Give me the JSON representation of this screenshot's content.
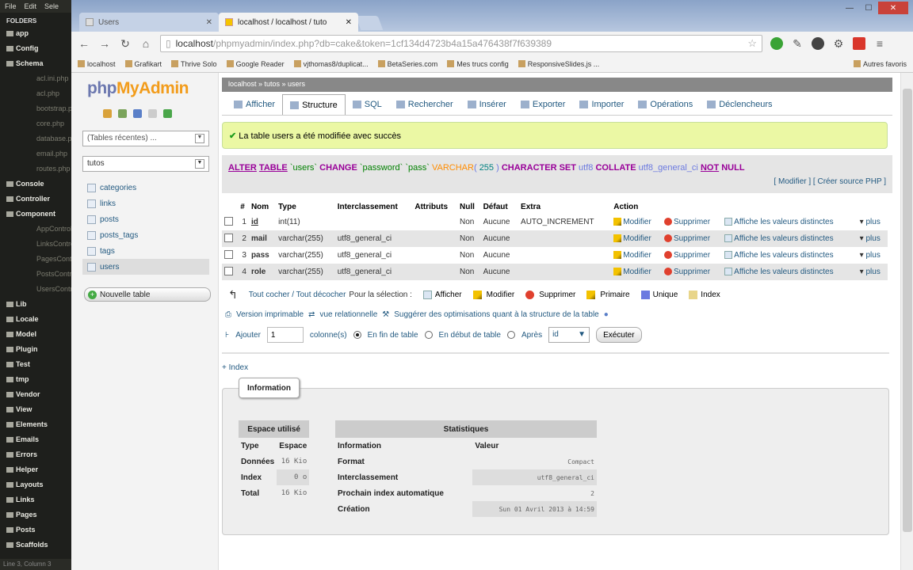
{
  "editor": {
    "menu": [
      "File",
      "Edit",
      "Sele"
    ],
    "folders_label": "FOLDERS",
    "tree": [
      {
        "label": "app",
        "type": "f"
      },
      {
        "label": "Config",
        "type": "f"
      },
      {
        "label": "Schema",
        "type": "f"
      },
      {
        "label": "acl.ini.php",
        "type": "fl"
      },
      {
        "label": "acl.php",
        "type": "fl"
      },
      {
        "label": "bootstrap.php",
        "type": "fl"
      },
      {
        "label": "core.php",
        "type": "fl"
      },
      {
        "label": "database.php",
        "type": "fl"
      },
      {
        "label": "email.php",
        "type": "fl"
      },
      {
        "label": "routes.php",
        "type": "fl"
      },
      {
        "label": "Console",
        "type": "f"
      },
      {
        "label": "Controller",
        "type": "f"
      },
      {
        "label": "Component",
        "type": "f"
      },
      {
        "label": "AppController",
        "type": "fl"
      },
      {
        "label": "LinksController",
        "type": "fl"
      },
      {
        "label": "PagesController",
        "type": "fl"
      },
      {
        "label": "PostsController",
        "type": "fl"
      },
      {
        "label": "UsersController",
        "type": "fl"
      },
      {
        "label": "Lib",
        "type": "f"
      },
      {
        "label": "Locale",
        "type": "f"
      },
      {
        "label": "Model",
        "type": "f"
      },
      {
        "label": "Plugin",
        "type": "f"
      },
      {
        "label": "Test",
        "type": "f"
      },
      {
        "label": "tmp",
        "type": "f"
      },
      {
        "label": "Vendor",
        "type": "f"
      },
      {
        "label": "View",
        "type": "f"
      },
      {
        "label": "Elements",
        "type": "f"
      },
      {
        "label": "Emails",
        "type": "f"
      },
      {
        "label": "Errors",
        "type": "f"
      },
      {
        "label": "Helper",
        "type": "f"
      },
      {
        "label": "Layouts",
        "type": "f"
      },
      {
        "label": "Links",
        "type": "f"
      },
      {
        "label": "Pages",
        "type": "f"
      },
      {
        "label": "Posts",
        "type": "f"
      },
      {
        "label": "Scaffolds",
        "type": "f"
      }
    ],
    "status": "Line 3, Column 3"
  },
  "browser": {
    "tab1": "Users",
    "tab2": "localhost / localhost / tuto",
    "url_host": "localhost",
    "url_rest": "/phpmyadmin/index.php?db=cake&token=1cf134d4723b4a15a476438f7f639389",
    "bookmarks": [
      "localhost",
      "Grafikart",
      "Thrive Solo",
      "Google Reader",
      "vjthomas8/duplicat...",
      "BetaSeries.com",
      "Mes trucs config",
      "ResponsiveSlides.js ..."
    ],
    "other_bookmarks": "Autres favoris"
  },
  "pma": {
    "logo_php": "php",
    "logo_my": "MyAdmin",
    "recent_tables": "(Tables récentes) ...",
    "database": "tutos",
    "tables": [
      "categories",
      "links",
      "posts",
      "posts_tags",
      "tags",
      "users"
    ],
    "new_table": "Nouvelle table",
    "breadcrumb": "localhost » tutos » users",
    "tabs": [
      "Afficher",
      "Structure",
      "SQL",
      "Rechercher",
      "Insérer",
      "Exporter",
      "Importer",
      "Opérations",
      "Déclencheurs"
    ],
    "success_msg": "La table users a été modifiée avec succès",
    "sql_links": "[ Modifier ] [ Créer source PHP ]",
    "headers": [
      "#",
      "Nom",
      "Type",
      "Interclassement",
      "Attributs",
      "Null",
      "Défaut",
      "Extra",
      "Action"
    ],
    "rows": [
      {
        "num": "1",
        "name": "id",
        "type": "int(11)",
        "coll": "",
        "attr": "",
        "null": "Non",
        "def": "Aucune",
        "extra": "AUTO_INCREMENT"
      },
      {
        "num": "2",
        "name": "mail",
        "type": "varchar(255)",
        "coll": "utf8_general_ci",
        "attr": "",
        "null": "Non",
        "def": "Aucune",
        "extra": ""
      },
      {
        "num": "3",
        "name": "pass",
        "type": "varchar(255)",
        "coll": "utf8_general_ci",
        "attr": "",
        "null": "Non",
        "def": "Aucune",
        "extra": ""
      },
      {
        "num": "4",
        "name": "role",
        "type": "varchar(255)",
        "coll": "utf8_general_ci",
        "attr": "",
        "null": "Non",
        "def": "Aucune",
        "extra": ""
      }
    ],
    "act_modify": "Modifier",
    "act_delete": "Supprimer",
    "act_distinct": "Affiche les valeurs distinctes",
    "act_more": "plus",
    "check_all": "Tout cocher / Tout décocher",
    "for_selection": "Pour la sélection :",
    "bulk": [
      "Afficher",
      "Modifier",
      "Supprimer",
      "Primaire",
      "Unique",
      "Index"
    ],
    "print_view": "Version imprimable",
    "relational_view": "vue relationnelle",
    "suggest": "Suggérer des optimisations quant à la structure de la table",
    "add_label": "Ajouter",
    "add_count": "1",
    "columns_label": "colonne(s)",
    "pos_end": "En fin de table",
    "pos_start": "En début de table",
    "pos_after": "Après",
    "after_col": "id",
    "execute": "Exécuter",
    "index_link": "+ Index",
    "info_legend": "Information",
    "space_caption": "Espace utilisé",
    "space_headers": [
      "Type",
      "Espace"
    ],
    "space_rows": [
      [
        "Données",
        "16 Kio"
      ],
      [
        "Index",
        "0 o"
      ],
      [
        "Total",
        "16 Kio"
      ]
    ],
    "stats_caption": "Statistiques",
    "stats_headers": [
      "Information",
      "Valeur"
    ],
    "stats_rows": [
      [
        "Format",
        "Compact"
      ],
      [
        "Interclassement",
        "utf8_general_ci"
      ],
      [
        "Prochain index automatique",
        "2"
      ],
      [
        "Création",
        "Sun 01 Avril 2013 à 14:59"
      ]
    ]
  }
}
